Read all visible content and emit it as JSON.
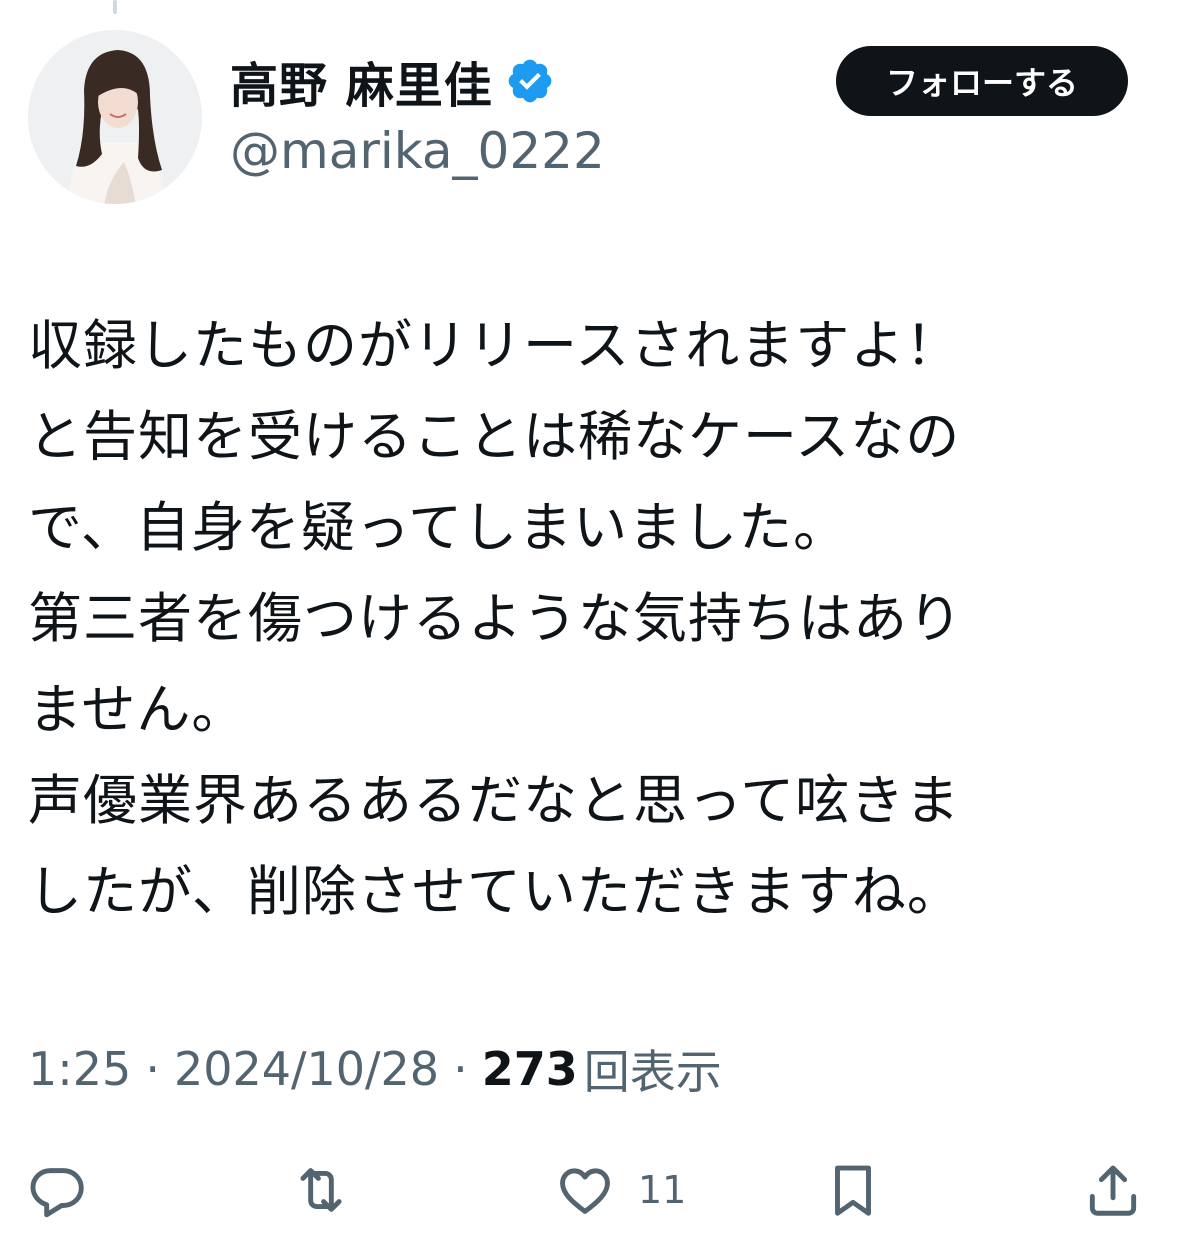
{
  "author": {
    "display_name": "高野 麻里佳",
    "handle": "@marika_0222",
    "verified": true,
    "verified_color": "#1d9bf0"
  },
  "follow_button": {
    "label": "フォローする"
  },
  "tweet": {
    "lines": [
      "収録したものがリリースされますよ！",
      "と告知を受けることは稀なケースなの",
      "で、自身を疑ってしまいました。",
      "第三者を傷つけるような気持ちはあり",
      "ません。",
      "声優業界あるあるだなと思って呟きま",
      "したが、削除させていただきますね。"
    ]
  },
  "meta": {
    "time": "1:25",
    "separator": "·",
    "date": "2024/10/28",
    "views_count": "273",
    "views_label": "回表示"
  },
  "actions": {
    "reply": {
      "icon": "reply-icon"
    },
    "retweet": {
      "icon": "retweet-icon"
    },
    "like": {
      "icon": "heart-icon",
      "count": "11"
    },
    "bookmark": {
      "icon": "bookmark-icon"
    },
    "share": {
      "icon": "share-icon"
    }
  },
  "colors": {
    "text": "#0f1419",
    "secondary": "#536471",
    "button_bg": "#0f1419",
    "button_text": "#ffffff"
  }
}
